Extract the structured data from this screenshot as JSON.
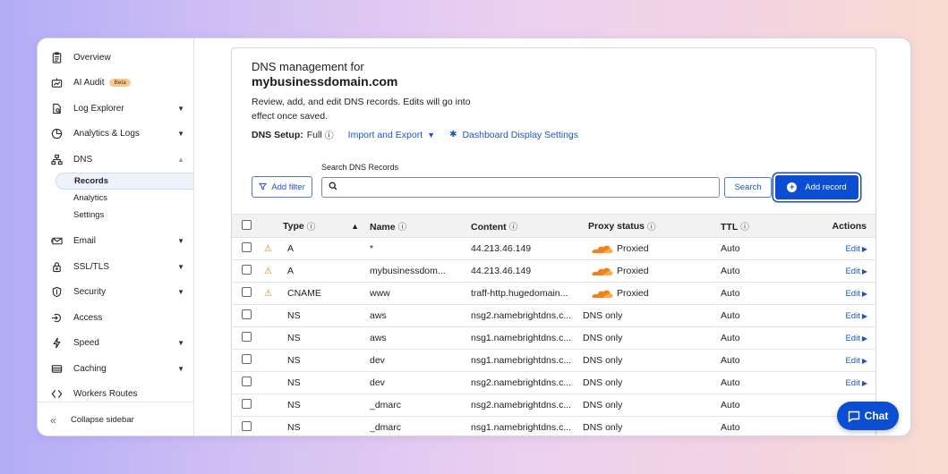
{
  "sidebar": {
    "items": [
      {
        "label": "Overview",
        "icon": "clipboard-icon"
      },
      {
        "label": "AI Audit",
        "icon": "chart-robot-icon",
        "badge": "Beta"
      },
      {
        "label": "Log Explorer",
        "icon": "document-search-icon",
        "caret": "down"
      },
      {
        "label": "Analytics & Logs",
        "icon": "pie-chart-icon",
        "caret": "down"
      },
      {
        "label": "DNS",
        "icon": "network-tree-icon",
        "caret": "up"
      }
    ],
    "dns_sub": [
      {
        "label": "Records",
        "active": true
      },
      {
        "label": "Analytics"
      },
      {
        "label": "Settings"
      }
    ],
    "items_after": [
      {
        "label": "Email",
        "icon": "email-icon",
        "caret": "down"
      },
      {
        "label": "SSL/TLS",
        "icon": "lock-icon",
        "caret": "down"
      },
      {
        "label": "Security",
        "icon": "shield-icon",
        "caret": "down"
      },
      {
        "label": "Access",
        "icon": "access-icon"
      },
      {
        "label": "Speed",
        "icon": "lightning-icon",
        "caret": "down"
      },
      {
        "label": "Caching",
        "icon": "database-icon",
        "caret": "down"
      },
      {
        "label": "Workers Routes",
        "icon": "code-brackets-icon"
      }
    ],
    "collapse_label": "Collapse sidebar"
  },
  "header": {
    "title_prefix": "DNS management for",
    "domain": "mybusinessdomain.com",
    "description": "Review, add, and edit DNS records. Edits will go into effect once saved.",
    "setup_label": "DNS Setup:",
    "setup_value": "Full",
    "import_export": "Import and Export",
    "display_settings": "Dashboard Display Settings"
  },
  "toolbar": {
    "add_filter": "Add filter",
    "search_label": "Search DNS Records",
    "search_placeholder": "",
    "search_button": "Search",
    "add_record": "Add record"
  },
  "table": {
    "columns": {
      "type": "Type",
      "name": "Name",
      "content": "Content",
      "proxy": "Proxy status",
      "ttl": "TTL",
      "actions": "Actions"
    },
    "rows": [
      {
        "warn": true,
        "type": "A",
        "name": "*",
        "content": "44.213.46.149",
        "proxy": "Proxied",
        "proxied": true,
        "ttl": "Auto",
        "action": "Edit"
      },
      {
        "warn": true,
        "type": "A",
        "name": "mybusinessdom...",
        "content": "44.213.46.149",
        "proxy": "Proxied",
        "proxied": true,
        "ttl": "Auto",
        "action": "Edit"
      },
      {
        "warn": true,
        "type": "CNAME",
        "name": "www",
        "content": "traff-http.hugedomain...",
        "proxy": "Proxied",
        "proxied": true,
        "ttl": "Auto",
        "action": "Edit"
      },
      {
        "warn": false,
        "type": "NS",
        "name": "aws",
        "content": "nsg2.namebrightdns.c...",
        "proxy": "DNS only",
        "proxied": false,
        "ttl": "Auto",
        "action": "Edit"
      },
      {
        "warn": false,
        "type": "NS",
        "name": "aws",
        "content": "nsg1.namebrightdns.c...",
        "proxy": "DNS only",
        "proxied": false,
        "ttl": "Auto",
        "action": "Edit"
      },
      {
        "warn": false,
        "type": "NS",
        "name": "dev",
        "content": "nsg1.namebrightdns.c...",
        "proxy": "DNS only",
        "proxied": false,
        "ttl": "Auto",
        "action": "Edit"
      },
      {
        "warn": false,
        "type": "NS",
        "name": "dev",
        "content": "nsg2.namebrightdns.c...",
        "proxy": "DNS only",
        "proxied": false,
        "ttl": "Auto",
        "action": "Edit"
      },
      {
        "warn": false,
        "type": "NS",
        "name": "_dmarc",
        "content": "nsg2.namebrightdns.c...",
        "proxy": "DNS only",
        "proxied": false,
        "ttl": "Auto",
        "action": ""
      },
      {
        "warn": false,
        "type": "NS",
        "name": "_dmarc",
        "content": "nsg1.namebrightdns.c...",
        "proxy": "DNS only",
        "proxied": false,
        "ttl": "Auto",
        "action": ""
      }
    ]
  },
  "chat": {
    "label": "Chat"
  },
  "colors": {
    "accent": "#0b4ed4",
    "link": "#1b55c8",
    "warning": "#d9811f",
    "cloud": "#f38020"
  }
}
